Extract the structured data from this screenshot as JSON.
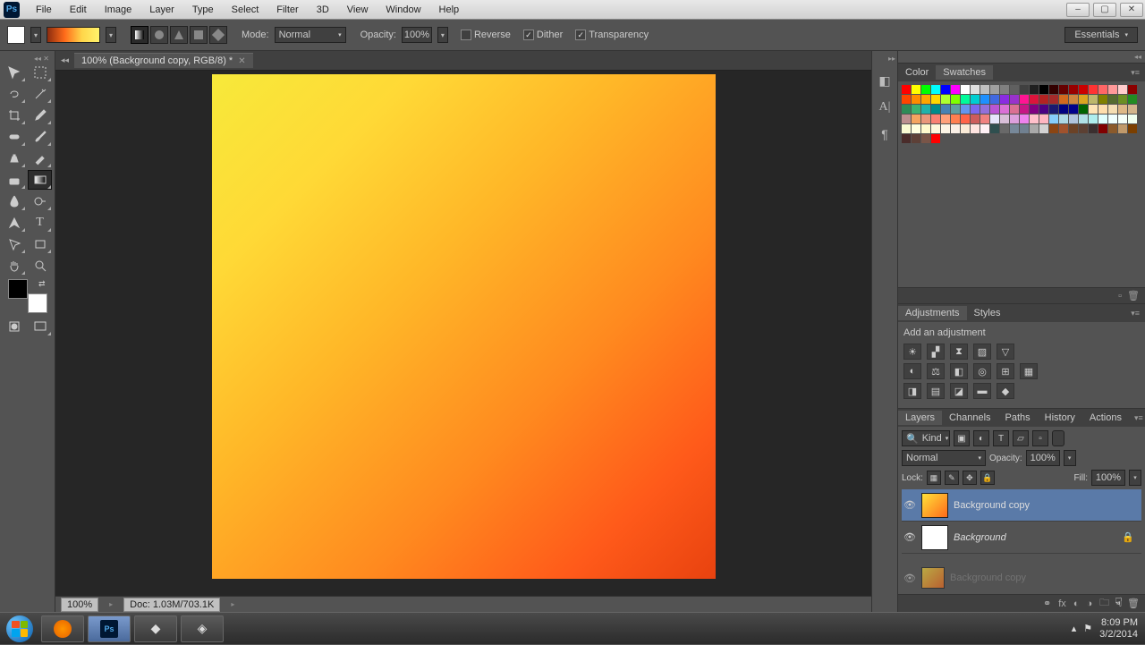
{
  "menu": {
    "items": [
      "File",
      "Edit",
      "Image",
      "Layer",
      "Type",
      "Select",
      "Filter",
      "3D",
      "View",
      "Window",
      "Help"
    ]
  },
  "window_controls": {
    "minimize": "–",
    "maximize": "▢",
    "close": "✕"
  },
  "opt": {
    "mode_label": "Mode:",
    "mode_value": "Normal",
    "opacity_label": "Opacity:",
    "opacity_value": "100%",
    "reverse": "Reverse",
    "dither": "Dither",
    "transparency": "Transparency",
    "workspace": "Essentials"
  },
  "doc": {
    "tab": "100% (Background copy, RGB/8) *",
    "zoom": "100%",
    "status": "Doc: 1.03M/703.1K"
  },
  "panels": {
    "color_tabs": [
      "Color",
      "Swatches"
    ],
    "adj_tabs": [
      "Adjustments",
      "Styles"
    ],
    "adj_title": "Add an adjustment",
    "layer_tabs": [
      "Layers",
      "Channels",
      "Paths",
      "History",
      "Actions"
    ],
    "kind": "Kind",
    "blend": "Normal",
    "opacity_label": "Opacity:",
    "opacity_value": "100%",
    "lock_label": "Lock:",
    "fill_label": "Fill:",
    "fill_value": "100%",
    "layers": [
      {
        "name": "Background copy",
        "italic": false,
        "locked": false,
        "selected": true,
        "thumb": "grad"
      },
      {
        "name": "Background",
        "italic": true,
        "locked": true,
        "selected": false,
        "thumb": "white"
      }
    ],
    "drag_layer": "Background copy"
  },
  "swatch_colors": [
    "#ff0000",
    "#ffff00",
    "#00ff00",
    "#00ffff",
    "#0000ff",
    "#ff00ff",
    "#ffffff",
    "#e0e0e0",
    "#c0c0c0",
    "#a0a0a0",
    "#808080",
    "#606060",
    "#404040",
    "#202020",
    "#000000",
    "#330000",
    "#660000",
    "#990000",
    "#cc0000",
    "#ff3333",
    "#ff6666",
    "#ff9999",
    "#ffcccc",
    "#8b0000",
    "#ff4500",
    "#ff8c00",
    "#ffa500",
    "#ffd700",
    "#adff2f",
    "#7fff00",
    "#00fa9a",
    "#00ced1",
    "#1e90ff",
    "#4169e1",
    "#8a2be2",
    "#9932cc",
    "#ff1493",
    "#dc143c",
    "#b22222",
    "#a52a2a",
    "#d2691e",
    "#cd853f",
    "#daa520",
    "#bdb76b",
    "#808000",
    "#556b2f",
    "#6b8e23",
    "#228b22",
    "#2e8b57",
    "#3cb371",
    "#20b2aa",
    "#008b8b",
    "#4682b4",
    "#5f9ea0",
    "#6495ed",
    "#7b68ee",
    "#9370db",
    "#ba55d3",
    "#da70d6",
    "#db7093",
    "#c71585",
    "#800080",
    "#4b0082",
    "#191970",
    "#000080",
    "#00008b",
    "#006400",
    "#ffe4b5",
    "#ffdead",
    "#f5deb3",
    "#deb887",
    "#d2b48c",
    "#bc8f8f",
    "#f4a460",
    "#e9967a",
    "#fa8072",
    "#ffa07a",
    "#ff7f50",
    "#ff6347",
    "#cd5c5c",
    "#f08080",
    "#e6e6fa",
    "#d8bfd8",
    "#dda0dd",
    "#ee82ee",
    "#ffc0cb",
    "#ffb6c1",
    "#87cefa",
    "#add8e6",
    "#b0c4de",
    "#b0e0e6",
    "#afeeee",
    "#e0ffff",
    "#f0ffff",
    "#f5fffa",
    "#f0fff0",
    "#fafad2",
    "#ffffe0",
    "#fffacd",
    "#fff8dc",
    "#fdf5e6",
    "#faf0e6",
    "#faebd7",
    "#ffe4e1",
    "#fff0f5",
    "#2f4f4f",
    "#696969",
    "#778899",
    "#708090",
    "#a9a9a9",
    "#d3d3d3",
    "#8b4513",
    "#a0522d",
    "#6b4226",
    "#5c4033",
    "#3b2f2f",
    "#800000",
    "#8b5a2b",
    "#c19a6b",
    "#7b3f00",
    "#4a2c2a",
    "#5d4037",
    "#795548",
    "#ff0000"
  ],
  "taskbar": {
    "time": "8:09 PM",
    "date": "3/2/2014"
  }
}
